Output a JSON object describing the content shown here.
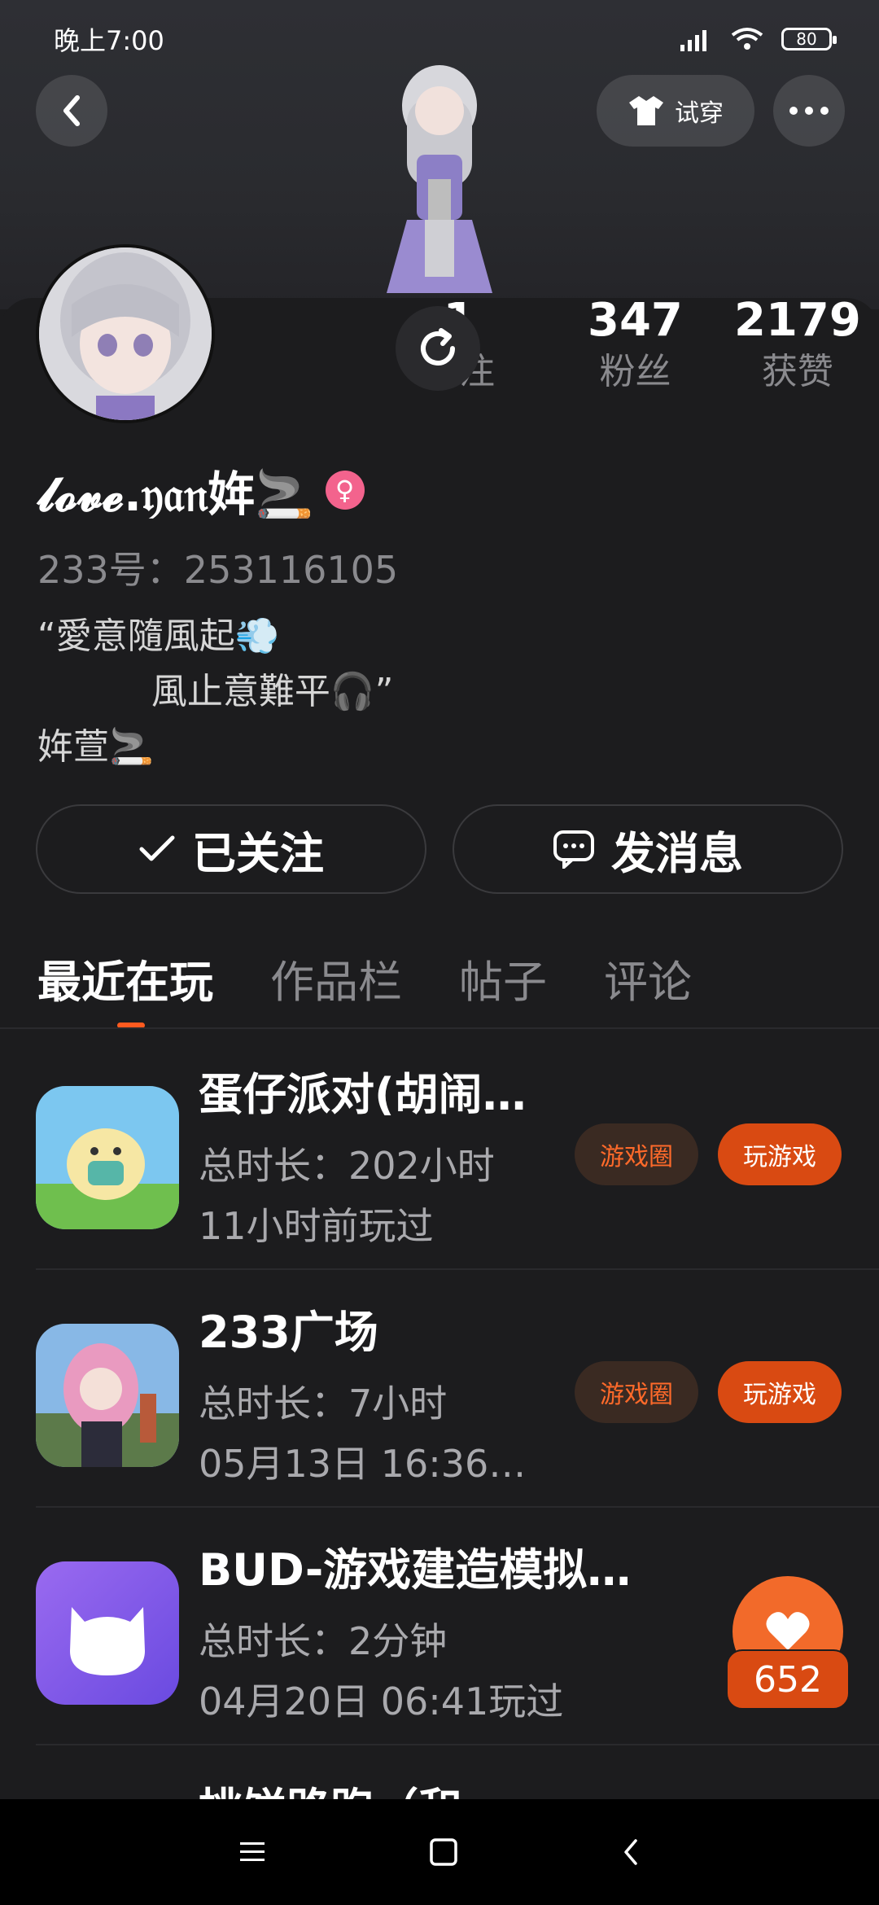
{
  "status_bar": {
    "time": "晚上7:00",
    "battery": "80"
  },
  "header": {
    "try_on_label": "试穿"
  },
  "stats": [
    {
      "num": "1",
      "label": "关注"
    },
    {
      "num": "347",
      "label": "粉丝"
    },
    {
      "num": "2179",
      "label": "获赞"
    }
  ],
  "profile": {
    "nickname": "𝓵𝓸𝓿𝓮.𝔶𝔞𝔫姩🚬",
    "uid": "233号：253116105",
    "bio": "“愛意隨風起💨\n          風止意難平🎧”\n姩萱🚬"
  },
  "actions": {
    "follow_label": "已关注",
    "message_label": "发消息"
  },
  "tabs": [
    "最近在玩",
    "作品栏",
    "帖子",
    "评论"
  ],
  "games": [
    {
      "title": "蛋仔派对(胡闹…",
      "duration": "总时长：202小时",
      "last_played": "11小时前玩过",
      "circle_label": "游戏圈",
      "play_label": "玩游戏"
    },
    {
      "title": "233广场",
      "duration": "总时长：7小时",
      "last_played": "05月13日 16:36…",
      "circle_label": "游戏圈",
      "play_label": "玩游戏"
    },
    {
      "title": "BUD-游戏建造模拟…",
      "duration": "总时长：2分钟",
      "last_played": "04月20日 06:41玩过",
      "circle_label": "",
      "play_label": ""
    }
  ],
  "partial_game_title": "桃饼路跑（和",
  "like": {
    "count": "652"
  },
  "colors": {
    "accent": "#ff5a1f",
    "play_button": "#d94a12",
    "background": "#1c1c1e"
  }
}
